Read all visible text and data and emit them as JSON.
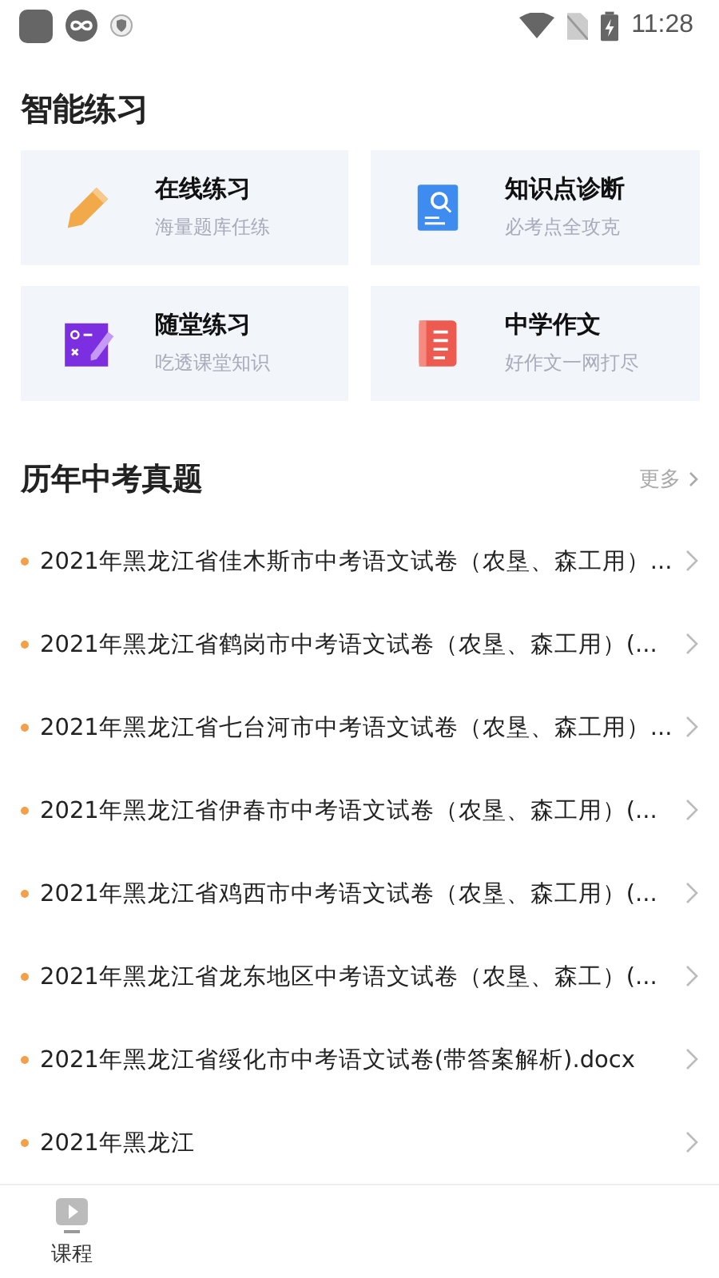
{
  "status_bar": {
    "time": "11:28"
  },
  "practice": {
    "title": "智能练习",
    "cards": [
      {
        "kind": "pencil",
        "title": "在线练习",
        "subtitle": "海量题库任练"
      },
      {
        "kind": "search-doc",
        "title": "知识点诊断",
        "subtitle": "必考点全攻克"
      },
      {
        "kind": "quiz",
        "title": "随堂练习",
        "subtitle": "吃透课堂知识"
      },
      {
        "kind": "book",
        "title": "中学作文",
        "subtitle": "好作文一网打尽"
      }
    ]
  },
  "exams": {
    "title": "历年中考真题",
    "more": "更多",
    "items": [
      "2021年黑龙江省佳木斯市中考语文试卷（农垦、森工用）...",
      "2021年黑龙江省鹤岗市中考语文试卷（农垦、森工用）(...",
      "2021年黑龙江省七台河市中考语文试卷（农垦、森工用）...",
      "2021年黑龙江省伊春市中考语文试卷（农垦、森工用）(...",
      "2021年黑龙江省鸡西市中考语文试卷（农垦、森工用）(...",
      "2021年黑龙江省龙东地区中考语文试卷（农垦、森工）(...",
      "2021年黑龙江省绥化市中考语文试卷(带答案解析).docx",
      "2021年黑龙江"
    ]
  },
  "bottom_nav": [
    {
      "label": "课程"
    }
  ]
}
